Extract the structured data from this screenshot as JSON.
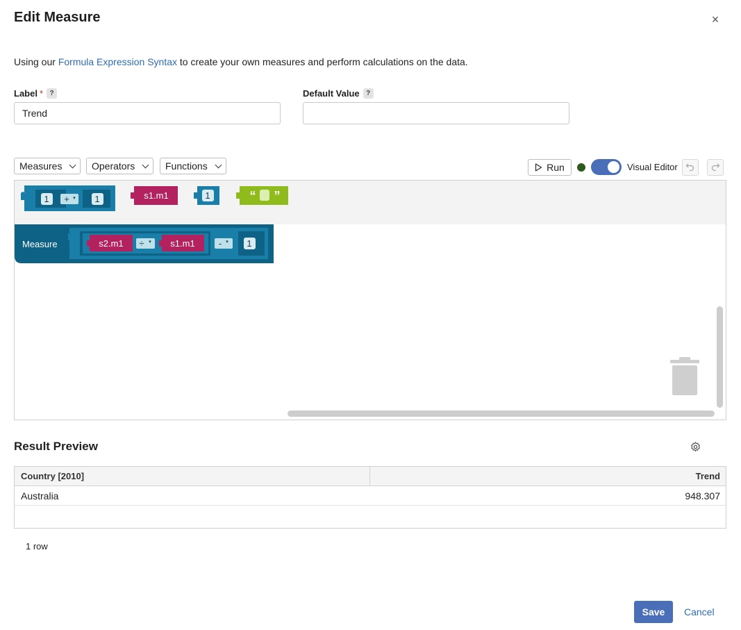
{
  "dialog": {
    "title": "Edit Measure",
    "close_label": "×"
  },
  "intro": {
    "prefix": "Using our ",
    "link_text": "Formula Expression Syntax",
    "suffix": " to create your own measures and perform calculations on the data."
  },
  "fields": {
    "label": {
      "label": "Label",
      "required_mark": "*",
      "help": "?",
      "value": "Trend"
    },
    "default_value": {
      "label": "Default Value",
      "help": "?",
      "value": ""
    }
  },
  "toolbar": {
    "measures": "Measures",
    "operators": "Operators",
    "functions": "Functions",
    "run": "Run",
    "status_color": "#2e5a1f",
    "visual_editor_label": "Visual Editor",
    "visual_editor_on": true,
    "undo_icon": "undo-icon",
    "redo_icon": "redo-icon"
  },
  "flyout": {
    "arith_left": "1",
    "arith_op": "+",
    "arith_right": "1",
    "measure_block": "s1.m1",
    "number_block": "1",
    "text_open": "“",
    "text_close": "”"
  },
  "workspace": {
    "measure_label": "Measure",
    "term1": "s2.m1",
    "op1": "÷",
    "term2": "s1.m1",
    "op2": "-",
    "term3": "1",
    "trash_icon": "trash-icon"
  },
  "preview": {
    "title": "Result Preview",
    "gear_icon": "gear-icon",
    "columns": [
      "Country [2010]",
      "Trend"
    ],
    "rows": [
      [
        "Australia",
        "948.307"
      ]
    ],
    "row_count": "1 row"
  },
  "footer": {
    "save": "Save",
    "cancel": "Cancel"
  },
  "colors": {
    "accent": "#4a6fb8",
    "link": "#2f6bb3",
    "block_blue": "#1a7fa8",
    "block_dark": "#0e6285",
    "block_magenta": "#b3225f",
    "block_green": "#8fbb1c"
  }
}
